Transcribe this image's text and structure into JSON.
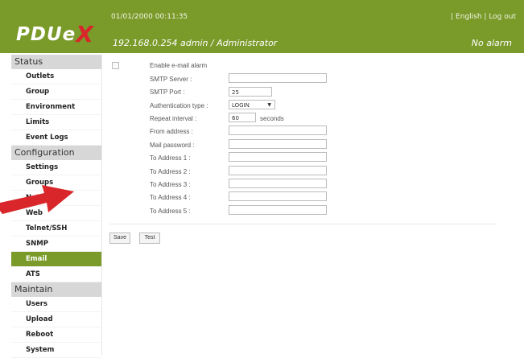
{
  "header": {
    "logo_main": "PDUe",
    "logo_x": "X",
    "logo_tag": "",
    "datetime": "01/01/2000 00:11:35",
    "english_link": "| English",
    "logout_link": "| Log out",
    "ip_user": "192.168.0.254  admin / Administrator",
    "alarm_status": "No alarm"
  },
  "sidebar": {
    "status_heading": "Status",
    "status_items": [
      "Outlets",
      "Group",
      "Environment",
      "Limits",
      "Event Logs"
    ],
    "config_heading": "Configuration",
    "config_items": [
      "Settings",
      "Groups",
      "Network",
      "Web",
      "Telnet/SSH",
      "SNMP",
      "Email",
      "ATS"
    ],
    "maintain_heading": "Maintain",
    "maintain_items": [
      "Users",
      "Upload",
      "Reboot",
      "System"
    ]
  },
  "form": {
    "enable_label": "Enable e-mail alarm",
    "smtp_server_label": "SMTP Server :",
    "smtp_server_value": "",
    "smtp_port_label": "SMTP Port :",
    "smtp_port_value": "25",
    "auth_type_label": "Authentication type :",
    "auth_type_value": "LOGIN",
    "repeat_label": "Repeat interval :",
    "repeat_value": "60",
    "repeat_suffix": "seconds",
    "from_label": "From address :",
    "mail_pw_label": "Mail password :",
    "to1_label": "To Address 1 :",
    "to2_label": "To Address 2 :",
    "to3_label": "To Address 3 :",
    "to4_label": "To Address 4 :",
    "to5_label": "To Address 5 :"
  },
  "buttons": {
    "save": "Save",
    "test": "Test"
  },
  "colors": {
    "header": "#7a9a2a",
    "active": "#7a9a2a",
    "accent_red": "#d8262a"
  }
}
